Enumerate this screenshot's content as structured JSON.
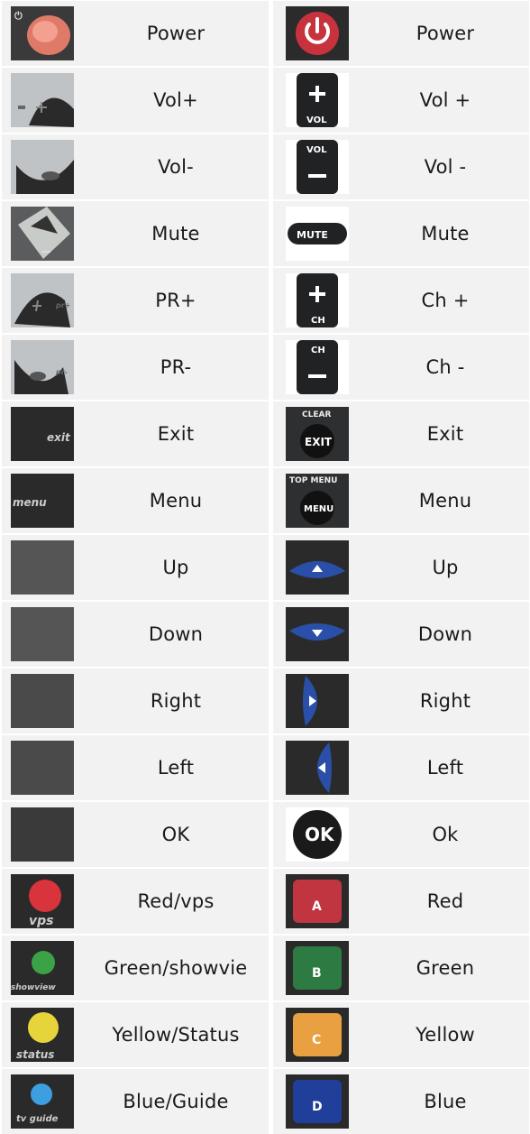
{
  "table": {
    "rows": [
      {
        "left_icon": "power-button-old",
        "left_label": "Power",
        "right_icon": "power-button-new",
        "right_label": "Power"
      },
      {
        "left_icon": "vol-up-old",
        "left_label": "Vol+",
        "right_icon": "vol-up-new",
        "right_label": "Vol +"
      },
      {
        "left_icon": "vol-down-old",
        "left_label": "Vol-",
        "right_icon": "vol-down-new",
        "right_label": "Vol -"
      },
      {
        "left_icon": "mute-old",
        "left_label": "Mute",
        "right_icon": "mute-new",
        "right_label": "Mute"
      },
      {
        "left_icon": "pr-up-old",
        "left_label": "PR+",
        "right_icon": "ch-up-new",
        "right_label": "Ch +"
      },
      {
        "left_icon": "pr-down-old",
        "left_label": "PR-",
        "right_icon": "ch-down-new",
        "right_label": "Ch -"
      },
      {
        "left_icon": "exit-old",
        "left_label": "Exit",
        "right_icon": "exit-new",
        "right_label": "Exit"
      },
      {
        "left_icon": "menu-old",
        "left_label": "Menu",
        "right_icon": "menu-new",
        "right_label": "Menu"
      },
      {
        "left_icon": "up-old",
        "left_label": "Up",
        "right_icon": "up-new",
        "right_label": "Up"
      },
      {
        "left_icon": "down-old",
        "left_label": "Down",
        "right_icon": "down-new",
        "right_label": "Down"
      },
      {
        "left_icon": "right-old",
        "left_label": "Right",
        "right_icon": "right-new",
        "right_label": "Right"
      },
      {
        "left_icon": "left-old",
        "left_label": "Left",
        "right_icon": "left-new",
        "right_label": "Left"
      },
      {
        "left_icon": "ok-old",
        "left_label": "OK",
        "right_icon": "ok-new",
        "right_label": "Ok"
      },
      {
        "left_icon": "red-old",
        "left_label": "Red/vps",
        "right_icon": "red-new",
        "right_label": "Red"
      },
      {
        "left_icon": "green-old",
        "left_label": "Green/showvie",
        "right_icon": "green-new",
        "right_label": "Green"
      },
      {
        "left_icon": "yellow-old",
        "left_label": "Yellow/Status",
        "right_icon": "yellow-new",
        "right_label": "Yellow"
      },
      {
        "left_icon": "blue-old",
        "left_label": "Blue/Guide",
        "right_icon": "blue-new",
        "right_label": "Blue"
      }
    ],
    "icon_text": {
      "vol": "VOL",
      "ch": "CH",
      "mute": "MUTE",
      "clear": "CLEAR",
      "exit_key": "EXIT",
      "exit_script": "exit",
      "top_menu": "TOP MENU",
      "menu_key": "MENU",
      "menu_script": "menu",
      "ok_key": "OK",
      "pr_plus": "pr+",
      "pr_minus": "pr-",
      "vps": "vps",
      "showview": "showview",
      "status": "status",
      "tv_guide": "tv guide",
      "key_a": "A",
      "key_b": "B",
      "key_c": "C",
      "key_d": "D"
    },
    "colors": {
      "cell_bg": "#f2f2f2",
      "power_red": "#c8323c",
      "blue_key": "#2a4fa8",
      "red_key": "#c0353f",
      "green_key": "#2e7a43",
      "yellow_key": "#e8a040",
      "navy_key": "#1f3f9a",
      "white_rubber": "#e6e8e6"
    }
  }
}
